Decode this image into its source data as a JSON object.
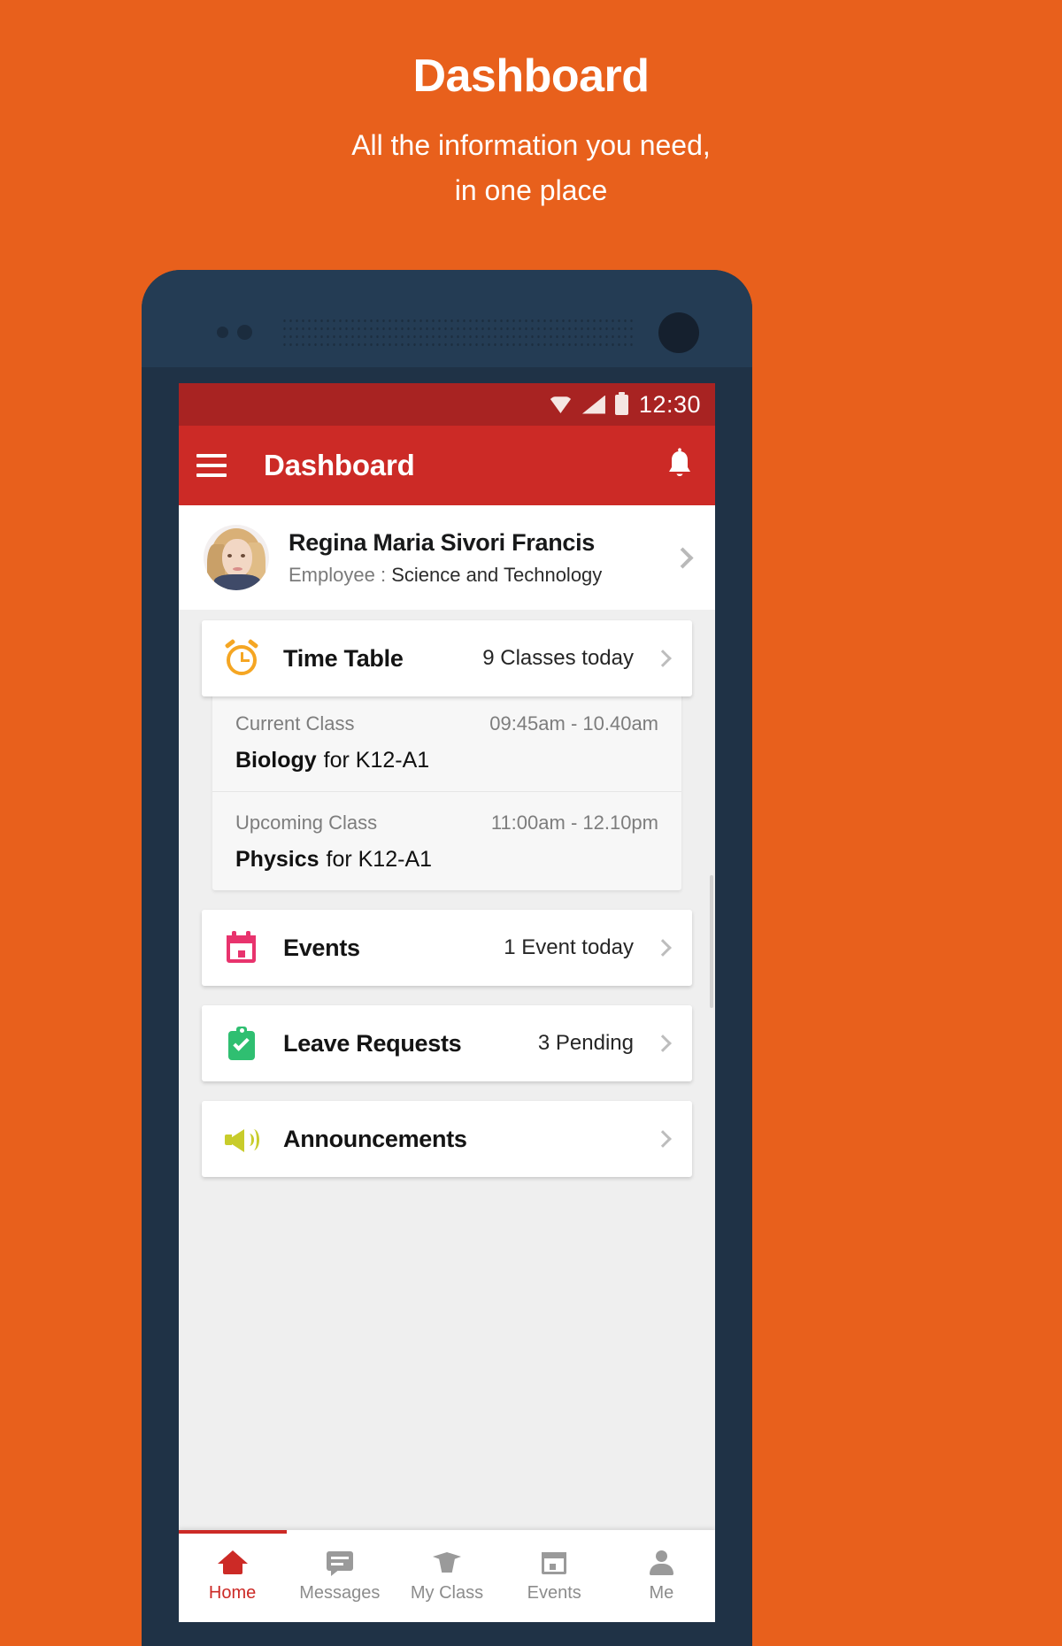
{
  "promo": {
    "title": "Dashboard",
    "subtitle_line1": "All the information you need,",
    "subtitle_line2": "in one place"
  },
  "status_bar": {
    "time": "12:30",
    "icons": [
      "wifi-icon",
      "signal-icon",
      "battery-icon"
    ]
  },
  "app_bar": {
    "menu_icon": "hamburger-menu-icon",
    "title": "Dashboard",
    "notification_icon": "bell-icon",
    "background_color": "#CC2A26"
  },
  "profile": {
    "avatar": "user-avatar",
    "name": "Regina Maria Sivori Francis",
    "role_label": "Employee :",
    "role_value": "Science and Technology",
    "chevron": "chevron-right-icon"
  },
  "cards": {
    "time_table": {
      "icon": "alarm-clock-icon",
      "icon_color": "#F5A623",
      "title": "Time Table",
      "meta": "9 Classes today",
      "chevron": "chevron-right-icon"
    },
    "events": {
      "icon": "calendar-icon",
      "icon_color": "#E8336D",
      "title": "Events",
      "meta": "1 Event today",
      "chevron": "chevron-right-icon"
    },
    "leave_requests": {
      "icon": "clipboard-check-icon",
      "icon_color": "#2FBF71",
      "title": "Leave Requests",
      "meta": "3 Pending",
      "chevron": "chevron-right-icon"
    },
    "announcements": {
      "icon": "megaphone-icon",
      "icon_color": "#C8CC2B",
      "title": "Announcements",
      "meta": "",
      "chevron": "chevron-right-icon"
    }
  },
  "timetable_detail": {
    "current": {
      "label": "Current Class",
      "time": "09:45am - 10.40am",
      "subject": "Biology",
      "section": "for K12-A1"
    },
    "upcoming": {
      "label": "Upcoming Class",
      "time": "11:00am - 12.10pm",
      "subject": "Physics",
      "section": "for K12-A1"
    }
  },
  "bottom_nav": {
    "active_color": "#CC2A26",
    "inactive_color": "#8C8C8C",
    "items": [
      {
        "label": "Home",
        "icon": "home-icon",
        "active": true
      },
      {
        "label": "Messages",
        "icon": "message-icon",
        "active": false
      },
      {
        "label": "My Class",
        "icon": "graduation-cap-icon",
        "active": false
      },
      {
        "label": "Events",
        "icon": "calendar-icon",
        "active": false
      },
      {
        "label": "Me",
        "icon": "person-icon",
        "active": false
      }
    ]
  }
}
